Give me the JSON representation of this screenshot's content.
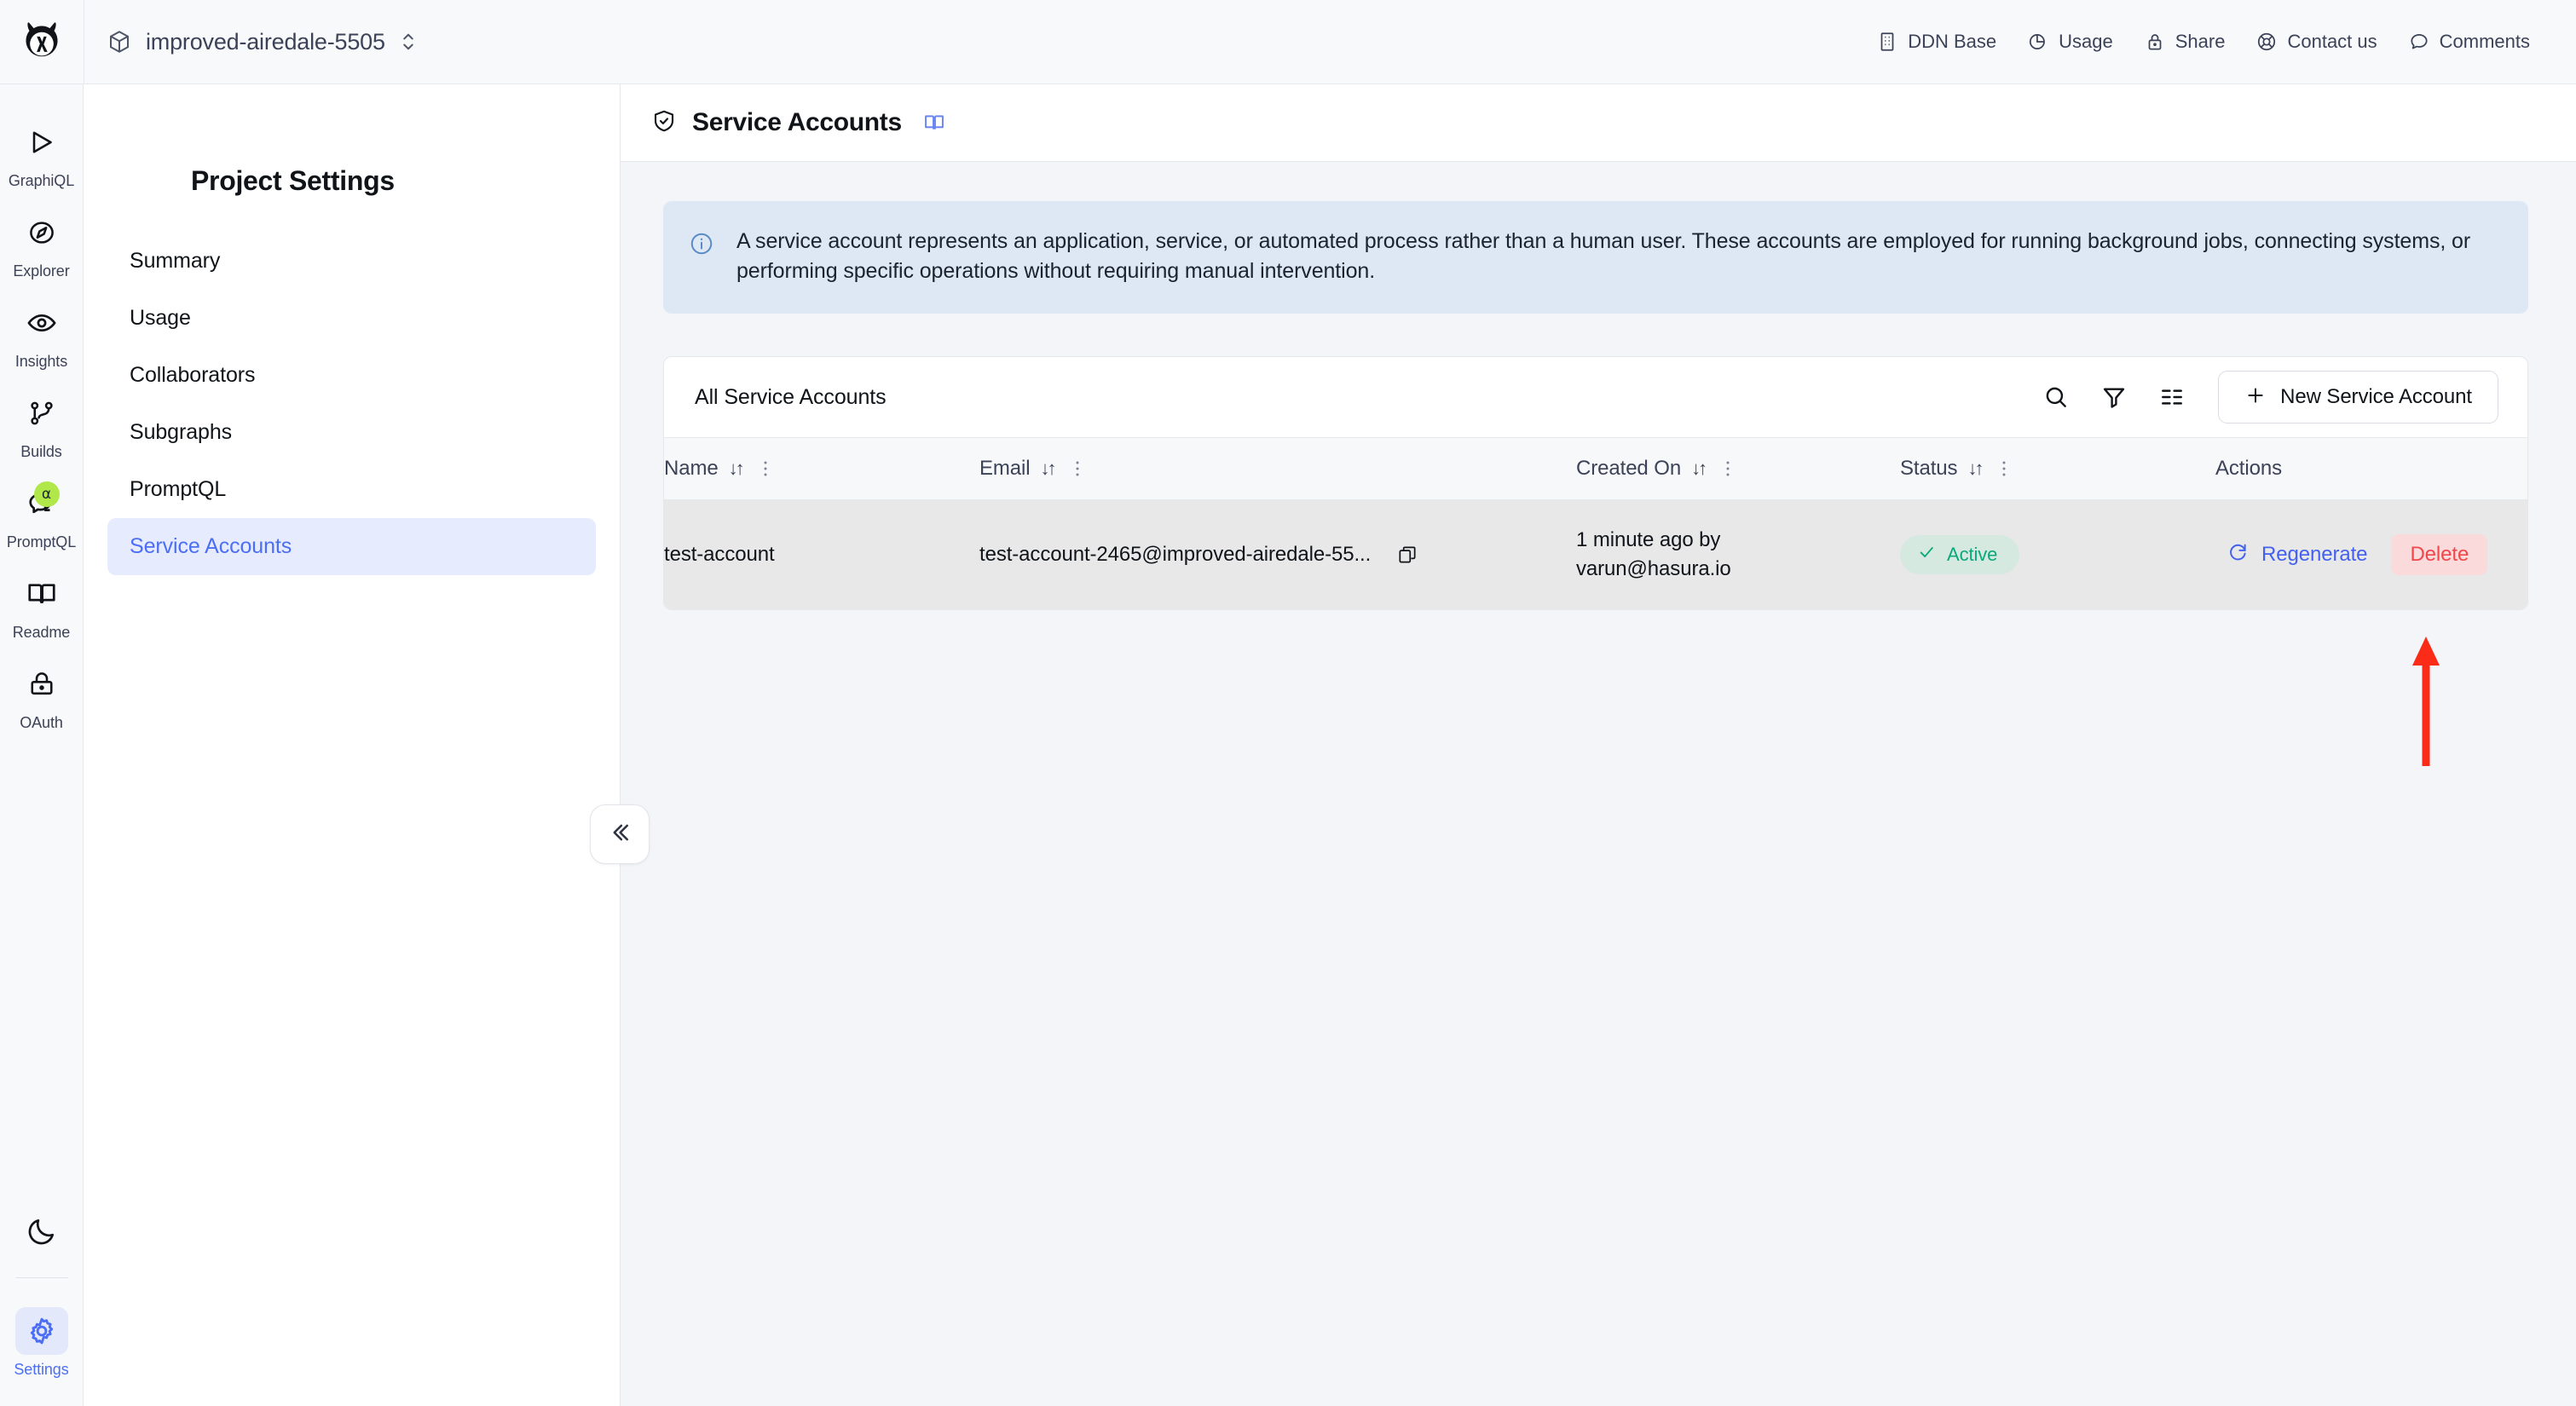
{
  "topbar": {
    "logo_icon": "hasura-logo-icon",
    "project_icon": "cube-icon",
    "project_name": "improved-airedale-5505",
    "project_switch_icon": "chevron-up-down-icon",
    "nav": [
      {
        "label": "DDN Base",
        "icon": "building-icon"
      },
      {
        "label": "Usage",
        "icon": "pie-chart-icon"
      },
      {
        "label": "Share",
        "icon": "lock-icon"
      },
      {
        "label": "Contact us",
        "icon": "lifebuoy-icon"
      },
      {
        "label": "Comments",
        "icon": "speech-bubble-icon"
      }
    ]
  },
  "rail": {
    "items": [
      {
        "label": "GraphiQL",
        "icon": "play-triangle-icon",
        "active": false,
        "badge": null
      },
      {
        "label": "Explorer",
        "icon": "compass-icon",
        "active": false,
        "badge": null
      },
      {
        "label": "Insights",
        "icon": "eye-icon",
        "active": false,
        "badge": null
      },
      {
        "label": "Builds",
        "icon": "git-branch-icon",
        "active": false,
        "badge": null
      },
      {
        "label": "PromptQL",
        "icon": "chat-bubble-icon",
        "active": false,
        "badge": "α"
      },
      {
        "label": "Readme",
        "icon": "book-open-icon",
        "active": false,
        "badge": null
      },
      {
        "label": "OAuth",
        "icon": "padlock-icon",
        "active": false,
        "badge": null
      }
    ],
    "theme_toggle": {
      "icon": "moon-icon"
    },
    "settings": {
      "label": "Settings",
      "icon": "gear-icon",
      "active": true
    }
  },
  "settings_panel": {
    "title": "Project Settings",
    "collapse_icon": "double-chevron-left-icon",
    "items": [
      {
        "label": "Summary",
        "active": false
      },
      {
        "label": "Usage",
        "active": false
      },
      {
        "label": "Collaborators",
        "active": false
      },
      {
        "label": "Subgraphs",
        "active": false
      },
      {
        "label": "PromptQL",
        "active": false
      },
      {
        "label": "Service Accounts",
        "active": true
      }
    ]
  },
  "page": {
    "title": "Service Accounts",
    "title_icon": "shield-check-icon",
    "docs_icon": "book-open-icon",
    "banner": {
      "icon": "info-circle-icon",
      "text": "A service account represents an application, service, or automated process rather than a human user. These accounts are employed for running background jobs, connecting systems, or performing specific operations without requiring manual intervention."
    },
    "table": {
      "toolbar_title": "All Service Accounts",
      "search_icon": "search-icon",
      "filter_icon": "funnel-icon",
      "density_icon": "list-settings-icon",
      "new_button": {
        "label": "New Service Account",
        "icon": "plus-icon"
      },
      "columns": [
        {
          "label": "Name",
          "sortable": true,
          "menu": true
        },
        {
          "label": "Email",
          "sortable": true,
          "menu": true
        },
        {
          "label": "Created On",
          "sortable": true,
          "menu": true
        },
        {
          "label": "Status",
          "sortable": true,
          "menu": true
        },
        {
          "label": "Actions",
          "sortable": false,
          "menu": false
        }
      ],
      "sort_glyph": "↓↑",
      "rows": [
        {
          "name": "test-account",
          "email": "test-account-2465@improved-airedale-55...",
          "copy_icon": "copy-icon",
          "created_on_line1": "1 minute ago by",
          "created_on_line2": "varun@hasura.io",
          "status": "Active",
          "status_icon": "check-icon",
          "actions": {
            "regenerate": {
              "label": "Regenerate",
              "icon": "refresh-icon"
            },
            "delete": {
              "label": "Delete"
            }
          }
        }
      ]
    }
  },
  "annotation": {
    "arrow": {
      "color": "#fa2c18",
      "points_to": "delete-button",
      "direction": "up"
    }
  },
  "colors": {
    "accent_blue": "#4c6ef5",
    "link_blue": "#4361ee",
    "danger_red": "#f0474b",
    "danger_bg": "#fadadb",
    "success_green": "#0aa87a",
    "success_bg": "#d6e9e1",
    "banner_bg": "#dde8f4",
    "rail_bg": "#f8f9fb",
    "main_bg": "#f4f5f8",
    "row_bg": "#e8e8e9",
    "badge_green": "#b0e849"
  }
}
